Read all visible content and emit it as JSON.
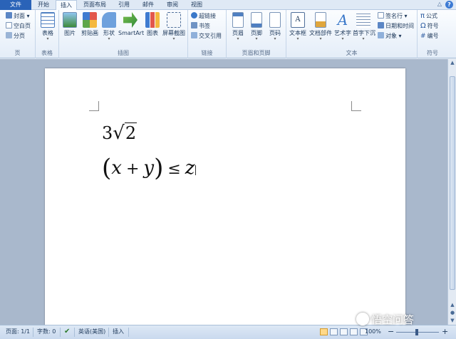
{
  "tabs": [
    "文件",
    "开始",
    "插入",
    "页面布局",
    "引用",
    "邮件",
    "审阅",
    "视图"
  ],
  "help_label": "?",
  "collapse_label": "△",
  "ribbon": {
    "page_group": {
      "label": "页",
      "items": [
        "封面",
        "空白页",
        "分页"
      ]
    },
    "table_group": {
      "label": "表格",
      "items": [
        "表格"
      ]
    },
    "illustrations_group": {
      "label": "插图",
      "items": [
        "图片",
        "剪贴画",
        "形状",
        "SmartArt",
        "图表",
        "屏幕截图"
      ]
    },
    "links_group": {
      "label": "链接",
      "items": [
        "超链接",
        "书签",
        "交叉引用"
      ]
    },
    "header_footer_group": {
      "label": "页眉和页脚",
      "items": [
        "页眉",
        "页脚",
        "页码"
      ]
    },
    "text_group": {
      "label": "文本",
      "items": [
        "文本框",
        "文档部件",
        "艺术字",
        "首字下沉"
      ],
      "side_items": [
        "签名行",
        "日期和时间",
        "对象"
      ]
    },
    "symbols_group": {
      "label": "符号",
      "items": [
        "公式",
        "符号",
        "编号"
      ],
      "icons": [
        "π",
        "Ω",
        "#"
      ]
    }
  },
  "document": {
    "eq1": {
      "coef": "3",
      "radical": "√",
      "radicand": "2"
    },
    "eq2": {
      "open": "(",
      "x": "x",
      "plus": "+",
      "y": "y",
      "close": ")",
      "leq": "≤",
      "z": "z"
    }
  },
  "status": {
    "page": "页面: 1/1",
    "words": "字数: 0",
    "language": "英语(美国)",
    "mode": "插入",
    "zoom": "100%",
    "zoom_minus": "−",
    "zoom_plus": "+"
  },
  "watermark": "悟空问答",
  "colors": {
    "file_tab": "#2a63b8",
    "ribbon_bg": "#e4edf8",
    "doc_bg": "#a9b8cc"
  }
}
